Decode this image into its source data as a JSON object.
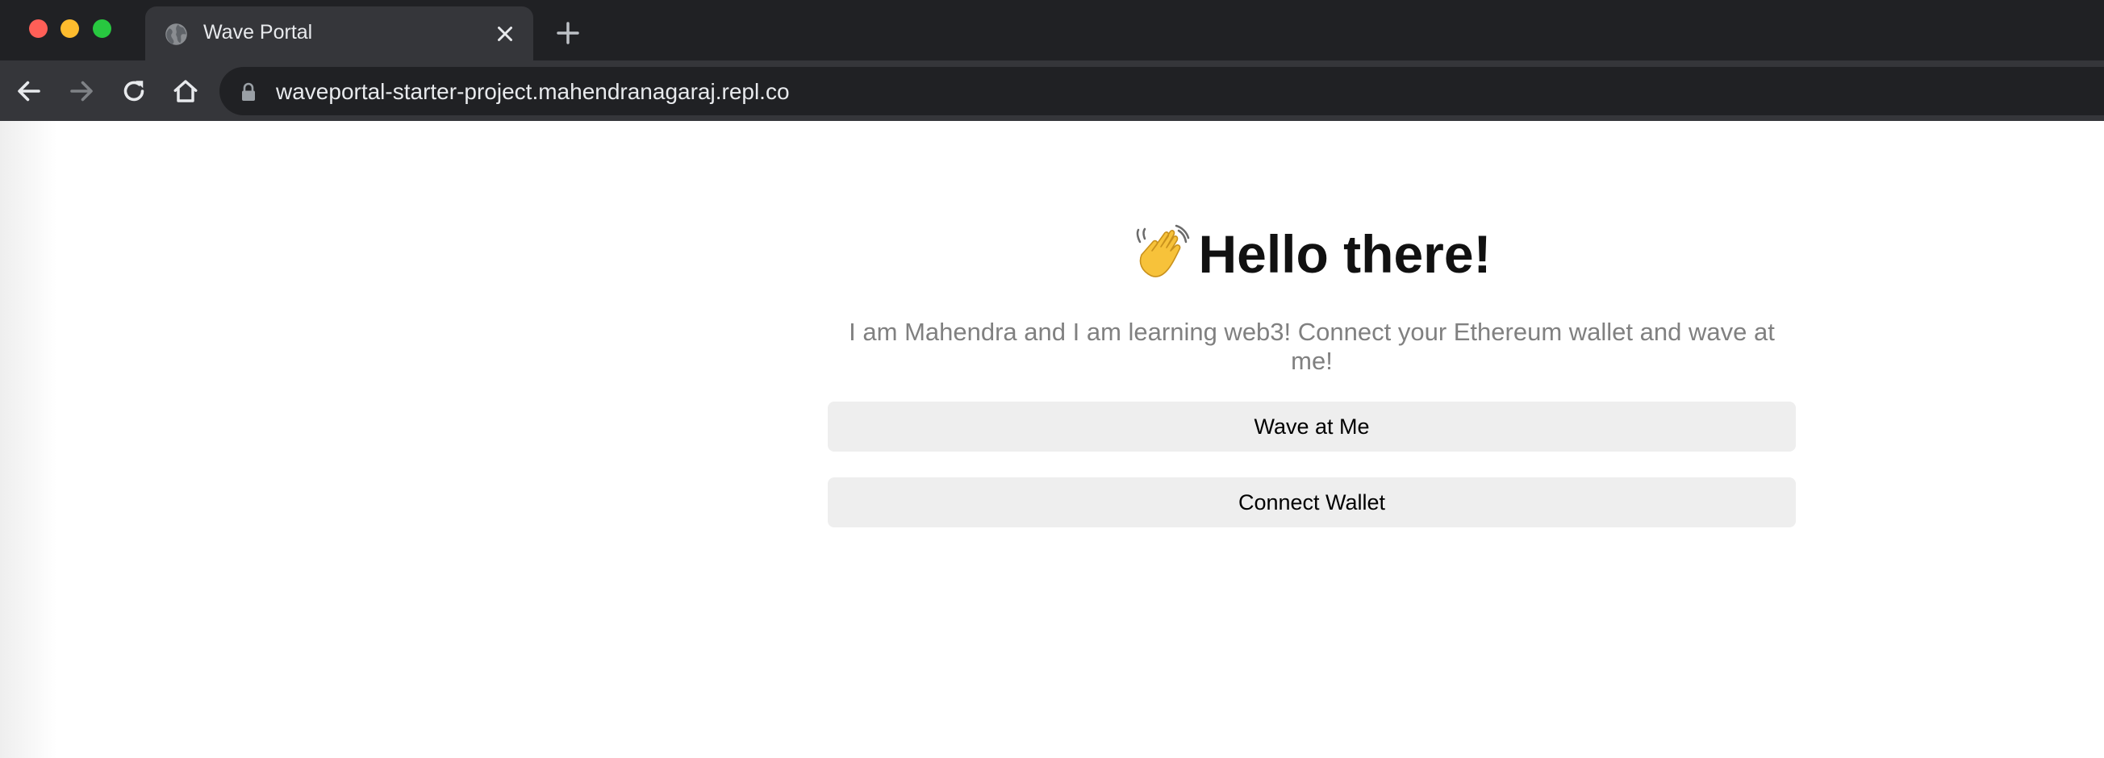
{
  "browser": {
    "tab_title": "Wave Portal",
    "url": "waveportal-starter-project.mahendranagaraj.repl.co"
  },
  "page": {
    "header": "Hello there!",
    "bio": "I am Mahendra and I am learning web3! Connect your Ethereum wallet and wave at me!",
    "wave_button": "Wave at Me",
    "connect_button": "Connect Wallet"
  },
  "icons": {
    "tab_favicon": "globe-icon",
    "tab_close": "close-icon",
    "new_tab": "plus-icon",
    "back": "arrow-left-icon",
    "forward": "arrow-right-icon",
    "reload": "reload-icon",
    "home": "home-icon",
    "lock": "lock-icon",
    "header_emoji": "waving-hand-icon"
  },
  "colors": {
    "chrome_dark": "#202124",
    "chrome_toolbar": "#35363a",
    "button_bg": "#eeeeee",
    "bio_text": "#808080"
  }
}
